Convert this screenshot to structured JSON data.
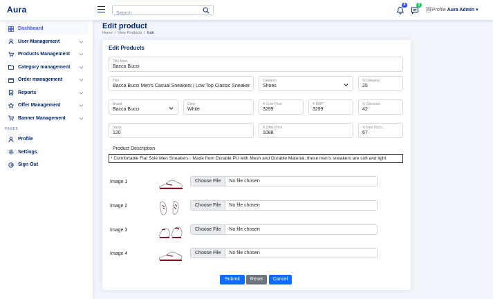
{
  "app": {
    "title": "Aura"
  },
  "header": {
    "search_placeholder": "Search",
    "notifications_count": "4",
    "messages_count": "3",
    "profile_img_alt": "Profile",
    "profile_name": "Aura Admin"
  },
  "sidebar": {
    "items": [
      {
        "label": "Dashboard",
        "icon": "grid-icon",
        "active": true
      },
      {
        "label": "User Management",
        "icon": "person-icon"
      },
      {
        "label": "Products Management",
        "icon": "cart-icon"
      },
      {
        "label": "Category management",
        "icon": "folder-icon"
      },
      {
        "label": "Order management",
        "icon": "box-icon"
      },
      {
        "label": "Reports",
        "icon": "document-icon"
      },
      {
        "label": "Offer Management",
        "icon": "star-icon"
      },
      {
        "label": "Banner Management",
        "icon": "cart-icon"
      }
    ],
    "pages_heading": "PAGES",
    "pages": [
      {
        "label": "Profile",
        "icon": "person-icon"
      },
      {
        "label": "Settings",
        "icon": "gear-icon"
      },
      {
        "label": "Sign Out",
        "icon": "signout-icon"
      }
    ]
  },
  "page": {
    "title": "Edit product",
    "breadcrumb": [
      "Home",
      "View Products",
      "Edit"
    ]
  },
  "form": {
    "card_title": "Edit Products",
    "title_main": {
      "label": "Title Main",
      "value": "Bacca Bucci"
    },
    "title": {
      "label": "Title",
      "value": "Bacca Bucci Men's Casual Sneakers | Low Top Classic Sneakers"
    },
    "category": {
      "label": "Category",
      "value": "Shoes"
    },
    "category_offer": {
      "label": "%Category",
      "value": "25"
    },
    "brand": {
      "label": "Brand",
      "value": "Bacca Bucci"
    },
    "color": {
      "label": "Color",
      "value": "White"
    },
    "cost_price": {
      "label": "₹ Cost Price",
      "value": "3299"
    },
    "mrp": {
      "label": "₹ MRP",
      "value": "3299"
    },
    "discount": {
      "label": "% Discount",
      "value": "42"
    },
    "stock": {
      "label": "Stock",
      "value": "120"
    },
    "offer_price": {
      "label": "₹ Offer Price",
      "value": "1088"
    },
    "total_discount": {
      "label": "%Total Disco...",
      "value": "67"
    },
    "description_label": "Product Description",
    "description": "* Comfortable Flat Sole Men Sneakers:- Made from Durable PU with Mesh and Durable Material, these men's sneakers are soft and light",
    "images": [
      {
        "label": "Image 1",
        "button": "Choose File",
        "status": "No file chosen"
      },
      {
        "label": "Image 2",
        "button": "Choose File",
        "status": "No file chosen"
      },
      {
        "label": "Image 3",
        "button": "Choose File",
        "status": "No file chosen"
      },
      {
        "label": "Image 4",
        "button": "Choose File",
        "status": "No file chosen"
      }
    ],
    "buttons": {
      "submit": "Submit",
      "reset": "Reset",
      "cancel": "Cancel"
    }
  },
  "colors": {
    "primary": "#4154f1",
    "navy": "#012970",
    "btn_blue": "#0d6efd",
    "btn_gray": "#6c757d",
    "shoe_accent": "#7a1a2e"
  }
}
